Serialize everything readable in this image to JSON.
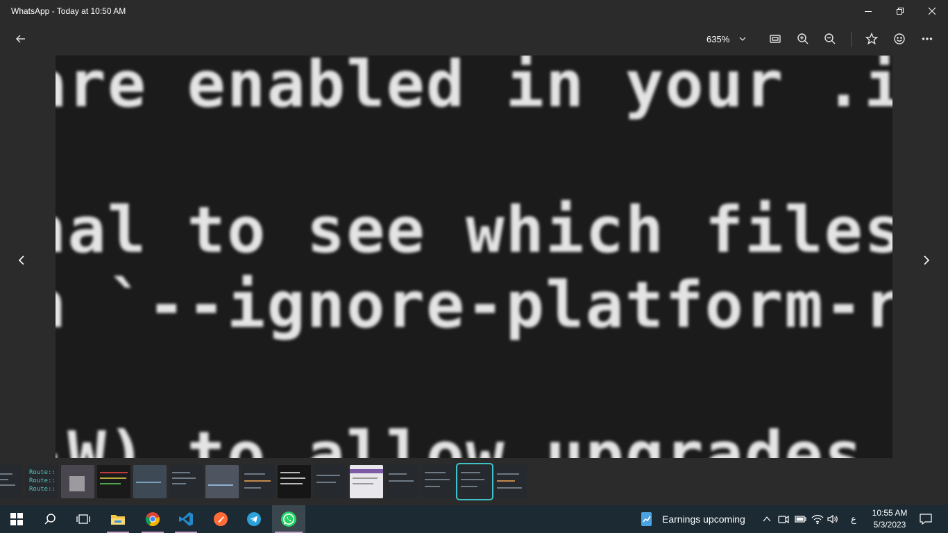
{
  "window": {
    "title": "WhatsApp - Today at 10:50 AM"
  },
  "toolbar": {
    "zoom_value": "635%",
    "icons": [
      "back-arrow-icon",
      "fit-screen-icon",
      "zoom-in-icon",
      "zoom-out-icon",
      "favorite-star-icon",
      "feedback-smiley-icon",
      "more-options-icon"
    ]
  },
  "image": {
    "lines": [
      "are enabled in your .ini fi",
      "nal to see which files are",
      "n `--ignore-platform-req=ex",
      "-W) to allow upgrades, do"
    ]
  },
  "filmstrip": {
    "thumb_text": "Route::\nRoute::\nRoute::"
  },
  "taskbar": {
    "apps": [
      "start",
      "search",
      "task-view",
      "file-explorer",
      "chrome",
      "vscode",
      "postman",
      "telegram",
      "whatsapp"
    ],
    "news_widget": "Earnings upcoming",
    "input_indicator": "ع",
    "time": "10:55 AM",
    "date": "5/3/2023"
  },
  "colors": {
    "accent": "#3fc1c9",
    "background": "#2b2b2b",
    "taskbar": "#1c2a33"
  }
}
